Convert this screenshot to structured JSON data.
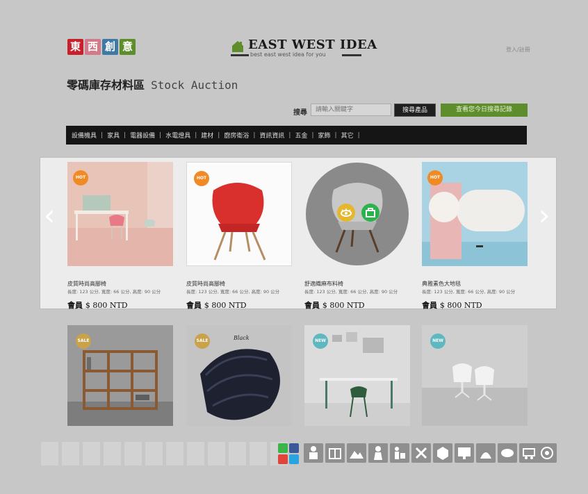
{
  "header": {
    "logo_chars": [
      {
        "char": "東",
        "color": "#c8202a"
      },
      {
        "char": "西",
        "color": "#d37a8a"
      },
      {
        "char": "創",
        "color": "#3f7aa4"
      },
      {
        "char": "意",
        "color": "#5e8d2c"
      }
    ],
    "brand_name": "EAST WEST IDEA",
    "brand_tagline": "best east west idea for you",
    "login_label": "登入/註冊"
  },
  "page_title": {
    "chinese": "零碼庫存材料區",
    "english": "Stock Auction"
  },
  "search": {
    "label": "搜尋",
    "placeholder": "請輸入關鍵字",
    "search_button": "搜尋產品",
    "history_button": "查看您今日搜尋記錄"
  },
  "nav": {
    "items": [
      "設備機具",
      "家具",
      "電器設備",
      "水電燈具",
      "建材",
      "廚房衛浴",
      "資訊資訊",
      "五金",
      "家飾",
      "其它"
    ]
  },
  "carousel": {
    "prev_arrow": "‹",
    "next_arrow": "›",
    "items": [
      {
        "name": "皮質時尚高腳椅",
        "spec": "長度: 123 公分, 寬度: 66 公分, 高度: 90 公分",
        "price_prefix": "會員",
        "price": "$ 800 NTD",
        "badge": "HOT"
      },
      {
        "name": "皮質時尚高腳椅",
        "spec": "長度: 123 公分, 寬度: 66 公分, 高度: 90 公分",
        "price_prefix": "會員",
        "price": "$ 800 NTD",
        "badge": "HOT"
      },
      {
        "name": "舒適織麻布料椅",
        "spec": "長度: 123 公分, 寬度: 66 公分, 高度: 90 公分",
        "price_prefix": "會員",
        "price": "$ 800 NTD",
        "badge": ""
      },
      {
        "name": "典雅素色大地毯",
        "spec": "長度: 123 公分, 寬度: 66 公分, 高度: 90 公分",
        "price_prefix": "會員",
        "price": "$ 800 NTD",
        "badge": "HOT"
      }
    ]
  },
  "grid": {
    "items": [
      {
        "badge": "SALE",
        "badge_color": "#c9a24a"
      },
      {
        "badge": "SALE",
        "badge_color": "#c9a24a",
        "label": "Black"
      },
      {
        "badge": "NEW",
        "badge_color": "#5fb8c0"
      },
      {
        "badge": "NEW",
        "badge_color": "#5fb8c0"
      }
    ]
  },
  "colors": {
    "accent_green": "#5e8d2c",
    "hot_orange": "#f08a24",
    "nav_bg": "#151515",
    "chair_red": "#d9302d"
  },
  "footer_icons": [
    "line-icon",
    "facebook-icon",
    "weibo-icon",
    "twitter-icon",
    "craftsman-icon",
    "package-icon",
    "landscape-icon",
    "worker-icon",
    "mover-icon",
    "tools-icon",
    "cube-icon",
    "board-icon",
    "garden-icon",
    "leaf-icon",
    "cart-icon",
    "target-icon"
  ]
}
